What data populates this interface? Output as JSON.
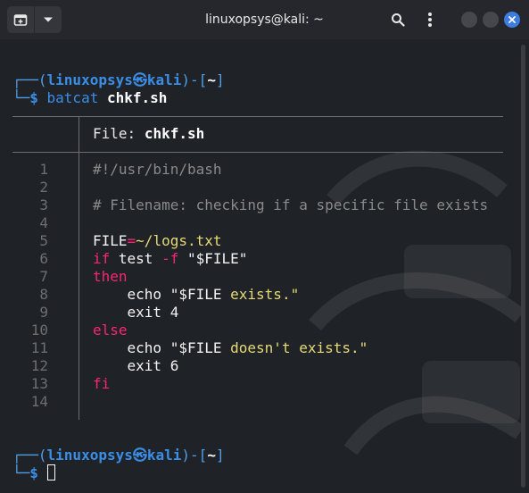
{
  "window": {
    "title": "linuxopsys@kali: ~"
  },
  "prompt1": {
    "user": "linuxopsys",
    "host": "kali",
    "dir": "~",
    "command": "batcat",
    "arg": "chkf.sh"
  },
  "bat": {
    "header_label": "File:",
    "header_file": "chkf.sh",
    "line_numbers": [
      "1",
      "2",
      "3",
      "4",
      "5",
      "6",
      "7",
      "8",
      "9",
      "10",
      "11",
      "12",
      "13",
      "14"
    ],
    "code": {
      "l1": "#!/usr/bin/bash",
      "l3": "# Filename: checking if a specific file exists",
      "l5_a": "FILE",
      "l5_b": "=",
      "l5_c": "~/logs.txt",
      "l6_a": "if",
      "l6_b": " test ",
      "l6_c": "-f",
      "l6_d": " \"$FILE\"",
      "l7": "then",
      "l8_a": "    echo ",
      "l8_b": "\"$FILE ",
      "l8_c": "exists.\"",
      "l9": "    exit 4",
      "l10": "else",
      "l11_a": "    echo ",
      "l11_b": "\"$FILE ",
      "l11_c": "doesn't exists.\"",
      "l12": "    exit 6",
      "l13": "fi"
    }
  },
  "prompt2": {
    "user": "linuxopsys",
    "host": "kali",
    "dir": "~"
  },
  "colors": {
    "prompt": "#3a8ee6",
    "keyword": "#f92672",
    "string": "#e6db74",
    "comment": "#8a8a8a",
    "close_button": "#3d7de0"
  }
}
